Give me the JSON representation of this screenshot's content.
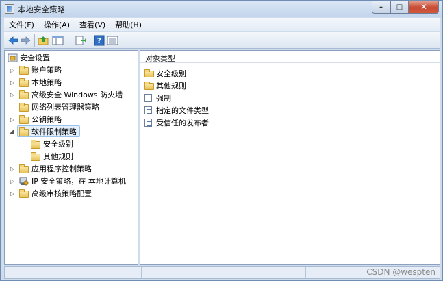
{
  "window": {
    "title": "本地安全策略"
  },
  "window_controls": {
    "minimize": "–",
    "maximize": "□",
    "close": "✕"
  },
  "menu": {
    "items": [
      "文件(F)",
      "操作(A)",
      "查看(V)",
      "帮助(H)"
    ]
  },
  "toolbar": {
    "icons": [
      "back-arrow-icon",
      "forward-arrow-icon",
      "up-folder-icon",
      "show-tree-icon",
      "export-list-icon",
      "help-icon",
      "view-icon"
    ]
  },
  "tree": {
    "items": [
      {
        "label": "安全设置",
        "icon": "security-settings-icon"
      },
      {
        "label": "账户策略",
        "icon": "folder-lock-icon",
        "expander": "▷"
      },
      {
        "label": "本地策略",
        "icon": "folder-lock-icon",
        "expander": "▷"
      },
      {
        "label": "高级安全 Windows 防火墙",
        "icon": "folder-icon",
        "expander": "▷"
      },
      {
        "label": "网络列表管理器策略",
        "icon": "folder-icon"
      },
      {
        "label": "公钥策略",
        "icon": "folder-icon",
        "expander": "▷"
      },
      {
        "label": "软件限制策略",
        "icon": "folder-icon",
        "expander": "◢",
        "selected": true
      },
      {
        "label": "安全级别",
        "icon": "folder-icon"
      },
      {
        "label": "其他规则",
        "icon": "folder-icon"
      },
      {
        "label": "应用程序控制策略",
        "icon": "folder-icon",
        "expander": "▷"
      },
      {
        "label": "IP 安全策略，在 本地计算机",
        "icon": "ip-security-icon",
        "expander": "▷"
      },
      {
        "label": "高级审核策略配置",
        "icon": "folder-icon",
        "expander": "▷"
      }
    ]
  },
  "list": {
    "column_header": "对象类型",
    "items": [
      {
        "label": "安全级别",
        "icon": "folder-icon"
      },
      {
        "label": "其他规则",
        "icon": "folder-icon"
      },
      {
        "label": "强制",
        "icon": "policy-document-icon"
      },
      {
        "label": "指定的文件类型",
        "icon": "policy-document-icon"
      },
      {
        "label": "受信任的发布者",
        "icon": "policy-document-icon"
      }
    ]
  },
  "watermark": "CSDN @wespten",
  "colors": {
    "title_bar": "#c9d9ee",
    "selection": "#e4f0fc",
    "close_button": "#c74a33"
  }
}
